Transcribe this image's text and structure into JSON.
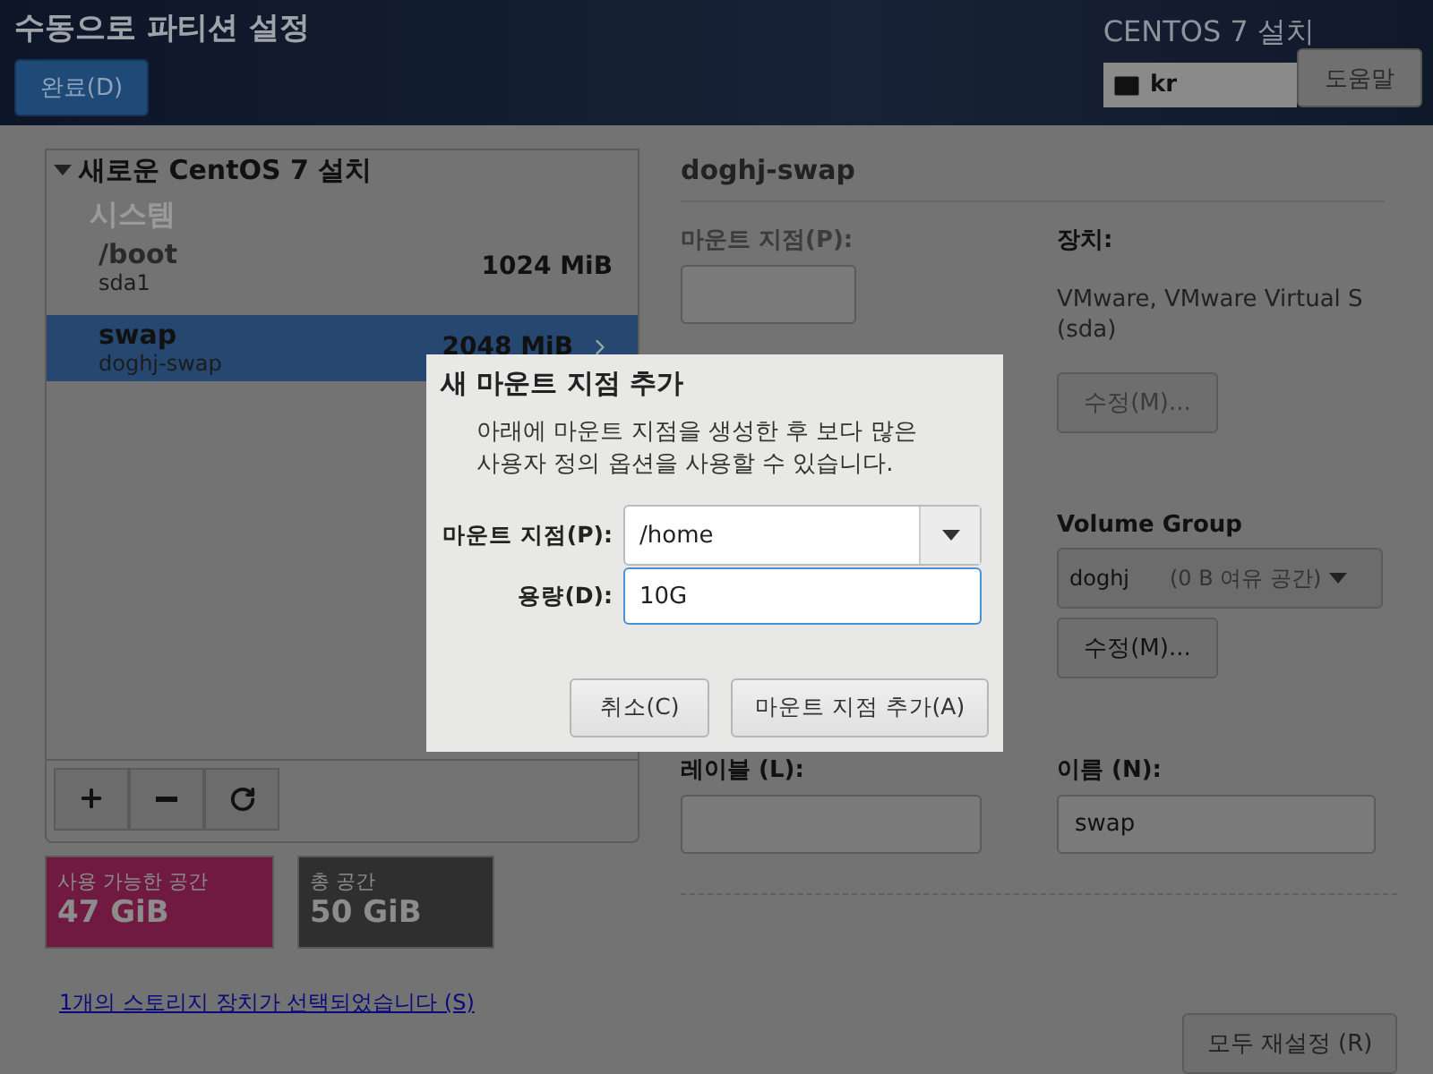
{
  "header": {
    "title": "수동으로 파티션 설정",
    "done_button": "완료(D)",
    "product_title": "CENTOS 7 설치",
    "keyboard_layout": "kr",
    "help_button": "도움말"
  },
  "partition_tree": {
    "title": "새로운 CentOS 7 설치",
    "expanded": true,
    "section": "시스템",
    "mounts": [
      {
        "name": "/boot",
        "device": "sda1",
        "size": "1024 MiB",
        "selected": false
      },
      {
        "name": "swap",
        "device": "doghj-swap",
        "size": "2048 MiB",
        "selected": true
      }
    ]
  },
  "space": {
    "available": {
      "label": "사용 가능한 공간",
      "value": "47 GiB"
    },
    "total": {
      "label": "총 공간",
      "value": "50 GiB"
    }
  },
  "storage_link": "1개의 스토리지 장치가 선택되었습니다 (S)",
  "details": {
    "title": "doghj-swap",
    "mount_label": "마운트 지점(P):",
    "mount_disabled": true,
    "device_label": "장치:",
    "device_text": "VMware, VMware Virtual S\n(sda)",
    "device_modify": {
      "label": "수정(M)...",
      "disabled": true
    },
    "volume_group_label": "Volume Group",
    "volume_group": "doghj",
    "volume_group_free": "(0 B 여유 공간)",
    "group_modify": {
      "label": "수정(M)...",
      "disabled": false
    },
    "label_label": "레이블 (L):",
    "name_label": "이름 (N):",
    "name_value": "swap"
  },
  "reset_button": "모두 재설정 (R)",
  "dialog": {
    "title": "새 마운트 지점 추가",
    "message": "아래에 마운트 지점을 생성한 후 보다 많은\n사용자 정의 옵션을 사용할 수 있습니다.",
    "mount_label": "마운트 지점(P):",
    "mount_value": "/home",
    "capacity_label": "용량(D):",
    "capacity_value": "10G",
    "cancel_button": "취소(C)",
    "add_button": "마운트 지점 추가(A)"
  }
}
